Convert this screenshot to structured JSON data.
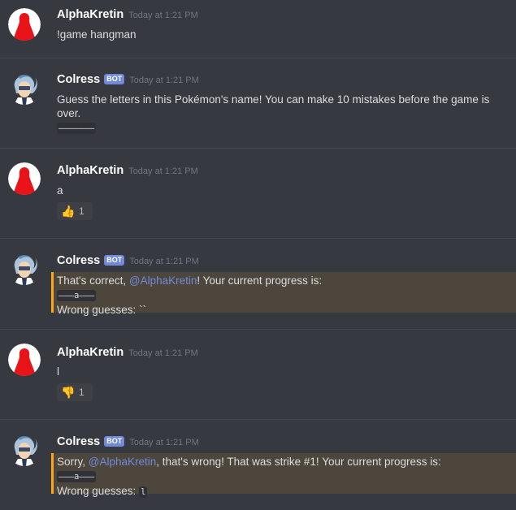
{
  "messages": [
    {
      "author": "AlphaKretin",
      "timestamp": "Today at 1:21 PM",
      "text": "!game hangman"
    },
    {
      "author": "Colress",
      "bot_tag": "BOT",
      "timestamp": "Today at 1:21 PM",
      "text_line1": "Guess the letters in this Pokémon's name! You can make 10 mistakes before the game is",
      "text_line2": "over.",
      "code": "———————"
    },
    {
      "author": "AlphaKretin",
      "timestamp": "Today at 1:21 PM",
      "text": "a",
      "reaction": {
        "emoji": "👍",
        "count": "1"
      }
    },
    {
      "author": "Colress",
      "bot_tag": "BOT",
      "timestamp": "Today at 1:21 PM",
      "prefix": "That's correct, ",
      "mention": "@AlphaKretin",
      "suffix": "! Your current progress is:",
      "code": "———a———",
      "wrong_label": "Wrong guesses: ",
      "wrong_value": "``"
    },
    {
      "author": "AlphaKretin",
      "timestamp": "Today at 1:21 PM",
      "text": "l",
      "reaction": {
        "emoji": "👎",
        "count": "1"
      }
    },
    {
      "author": "Colress",
      "bot_tag": "BOT",
      "timestamp": "Today at 1:21 PM",
      "prefix": "Sorry, ",
      "mention": "@AlphaKretin",
      "suffix": ", that's wrong! That was strike #1! Your current progress is:",
      "code": "———a———",
      "wrong_label": "Wrong guesses: ",
      "wrong_value": "l"
    }
  ],
  "colors": {
    "background": "#36393f",
    "mention": "#7289da",
    "bot_tag": "#7289da",
    "highlight_bar": "#faa61a",
    "highlight_bg": "#4c463d"
  }
}
